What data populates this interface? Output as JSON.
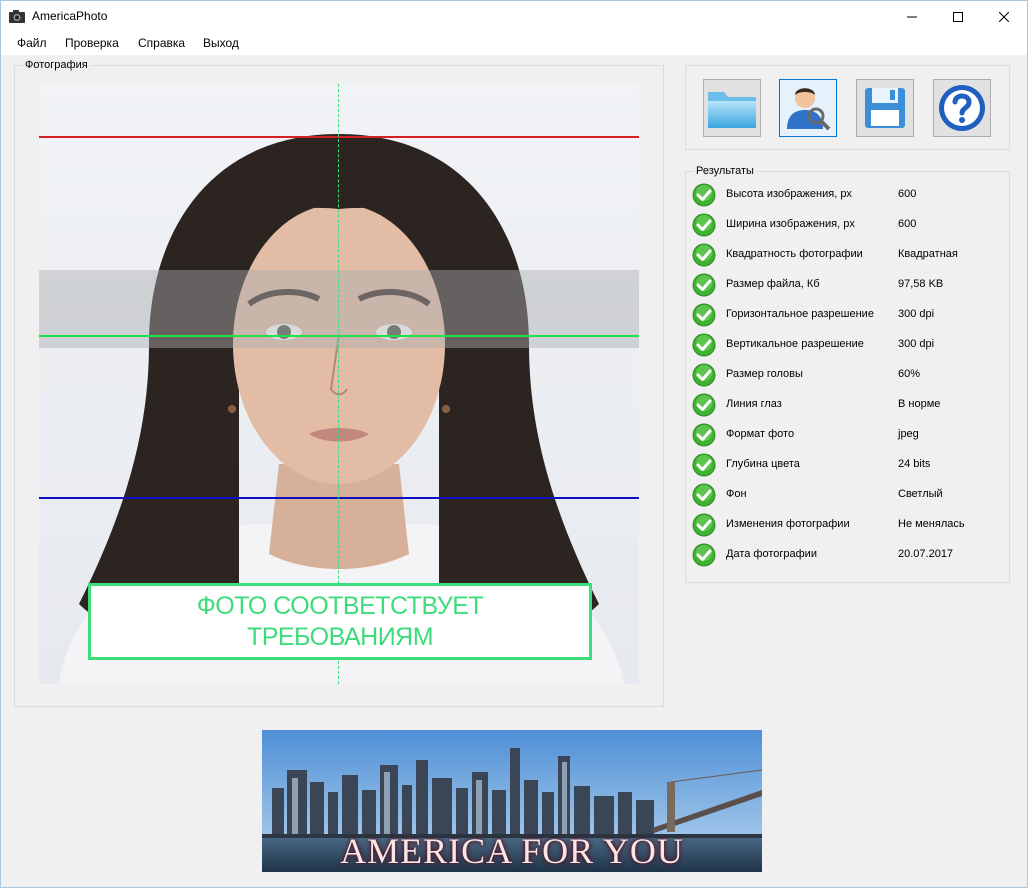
{
  "window": {
    "title": "AmericaPhoto"
  },
  "menu": [
    "Файл",
    "Проверка",
    "Справка",
    "Выход"
  ],
  "photo_group": {
    "label": "Фотография"
  },
  "verdict": {
    "line1": "ФОТО СООТВЕТСТВУЕТ",
    "line2": "ТРЕБОВАНИЯМ",
    "color": "#3ddc7a"
  },
  "guide_lines": {
    "top_color": "#d42020",
    "eye_color": "#22e04a",
    "chin_color": "#1010c0",
    "center_color": "#3ddc7a"
  },
  "toolbar": [
    {
      "name": "open-folder",
      "icon": "folder-icon"
    },
    {
      "name": "check-face",
      "icon": "face-search-icon"
    },
    {
      "name": "save",
      "icon": "floppy-disk-icon"
    },
    {
      "name": "help",
      "icon": "question-mark-icon"
    }
  ],
  "results": {
    "label": "Результаты",
    "rows": [
      {
        "label": "Высота изображения, px",
        "value": "600"
      },
      {
        "label": "Ширина изображения, px",
        "value": "600"
      },
      {
        "label": "Квадратность фотографии",
        "value": "Квадратная"
      },
      {
        "label": "Размер файла,  Кб",
        "value": "97,58 KB"
      },
      {
        "label": "Горизонтальное разрешение",
        "value": "300 dpi"
      },
      {
        "label": "Вертикальное разрешение",
        "value": "300 dpi"
      },
      {
        "label": "Размер головы",
        "value": "60%"
      },
      {
        "label": "Линия глаз",
        "value": "В норме"
      },
      {
        "label": "Формат фото",
        "value": "jpeg"
      },
      {
        "label": "Глубина цвета",
        "value": "24 bits"
      },
      {
        "label": "Фон",
        "value": "Светлый"
      },
      {
        "label": "Изменения фотографии",
        "value": "Не менялась"
      },
      {
        "label": "Дата фотографии",
        "value": "20.07.2017"
      }
    ]
  },
  "banner": {
    "text": "AMERICA FOR YOU"
  }
}
